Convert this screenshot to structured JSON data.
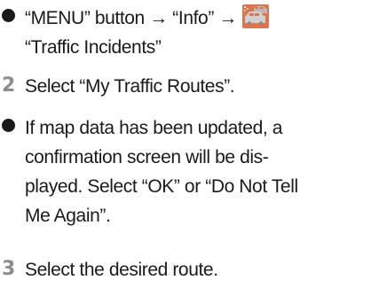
{
  "instructions": {
    "bullet_1": {
      "part1": "“MENU” button → “Info” →",
      "part2": "“Traffic Incidents”",
      "icon": "traffic-incidents-icon"
    },
    "step_2": {
      "number": "2",
      "text": "Select “My Traffic Routes”."
    },
    "bullet_2": {
      "line1": "If map data has been updated, a",
      "line2": "confirmation screen will be dis-",
      "line3": "played. Select “OK” or “Do Not Tell",
      "line4": "Me Again”."
    },
    "step_3": {
      "number": "3",
      "text": "Select the desired route."
    }
  },
  "colors": {
    "text": "#1a1a1a",
    "step_number": "#8c8c8c",
    "icon_background": "#e0734c",
    "icon_car": "#c8c8c8"
  }
}
